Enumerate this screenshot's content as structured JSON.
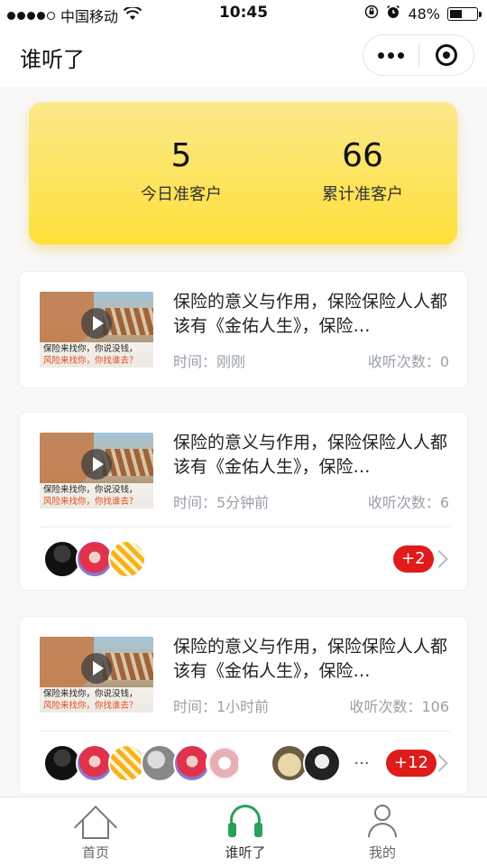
{
  "status_bar": {
    "carrier": "中国移动",
    "time": "10:45",
    "battery": "48%",
    "battery_level": 0.48
  },
  "nav": {
    "title": "谁听了"
  },
  "stats": {
    "today_count": "5",
    "today_label": "今日准客户",
    "total_count": "66",
    "total_label": "累计准客户"
  },
  "thumbnail_caption": {
    "line1": "保险来找你，你说没钱，",
    "line2": "风险来找你，你找谁去？"
  },
  "cards": [
    {
      "title": "保险的意义与作用，保险保险人人都该有《金佑人生》，保险…",
      "time": "时间：刚刚",
      "plays": "收听次数：0"
    },
    {
      "title": "保险的意义与作用，保险保险人人都该有《金佑人生》，保险…",
      "time": "时间：5分钟前",
      "plays": "收听次数：6",
      "more_count": "+2"
    },
    {
      "title": "保险的意义与作用，保险保险人人都该有《金佑人生》，保险…",
      "time": "时间：1小时前",
      "plays": "收听次数：106",
      "more_count": "+12",
      "ellipsis": "···"
    }
  ],
  "tabs": [
    {
      "label": "首页",
      "icon": "home-icon"
    },
    {
      "label": "谁听了",
      "icon": "headphone-icon"
    },
    {
      "label": "我的",
      "icon": "user-icon"
    }
  ],
  "colors": {
    "accent_yellow": "#ffe03b",
    "badge_red": "#e01b1b",
    "meta_gray": "#9aa0a8",
    "active_tab_green": "#2aa05a"
  }
}
